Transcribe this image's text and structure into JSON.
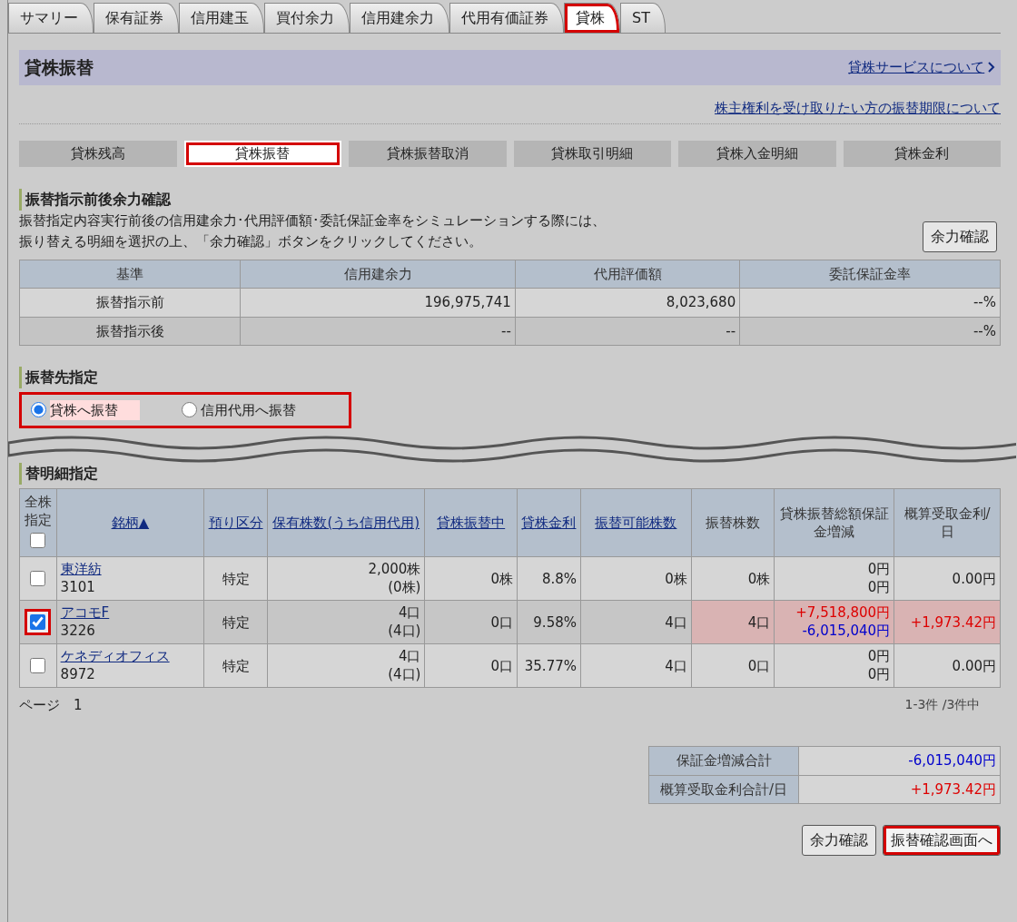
{
  "tabs": [
    {
      "label": "サマリー",
      "selected": false,
      "highlighted": false
    },
    {
      "label": "保有証券",
      "selected": false,
      "highlighted": false
    },
    {
      "label": "信用建玉",
      "selected": false,
      "highlighted": false
    },
    {
      "label": "買付余力",
      "selected": false,
      "highlighted": false
    },
    {
      "label": "信用建余力",
      "selected": false,
      "highlighted": false
    },
    {
      "label": "代用有価証券",
      "selected": false,
      "highlighted": false
    },
    {
      "label": "貸株",
      "selected": true,
      "highlighted": true
    },
    {
      "label": "ST",
      "selected": false,
      "highlighted": false
    }
  ],
  "page_title": "貸株振替",
  "service_link": "貸株サービスについて",
  "deadline_link": "株主権利を受け取りたい方の振替期限について",
  "subtabs": [
    {
      "label": "貸株残高",
      "selected": false,
      "highlighted": false
    },
    {
      "label": "貸株振替",
      "selected": true,
      "highlighted": true
    },
    {
      "label": "貸株振替取消",
      "selected": false,
      "highlighted": false
    },
    {
      "label": "貸株取引明細",
      "selected": false,
      "highlighted": false
    },
    {
      "label": "貸株入金明細",
      "selected": false,
      "highlighted": false
    },
    {
      "label": "貸株金利",
      "selected": false,
      "highlighted": false
    }
  ],
  "simulation": {
    "heading": "振替指示前後余力確認",
    "description": [
      "振替指定内容実行前後の信用建余力･代用評価額･委託保証金率をシミュレーションする際には、",
      "振り替える明細を選択の上、「余力確認」ボタンをクリックしてください。"
    ],
    "button": "余力確認",
    "columns": [
      "基準",
      "信用建余力",
      "代用評価額",
      "委託保証金率"
    ],
    "rows": [
      {
        "label": "振替指示前",
        "values": [
          "196,975,741",
          "8,023,680",
          "--%"
        ]
      },
      {
        "label": "振替指示後",
        "values": [
          "--",
          "--",
          "--%"
        ]
      }
    ]
  },
  "destination": {
    "heading": "振替先指定",
    "highlighted": true,
    "options": [
      {
        "label": "貸株へ振替",
        "selected": true
      },
      {
        "label": "信用代用へ振替",
        "selected": false
      }
    ]
  },
  "transfer": {
    "heading": "替明細指定",
    "columns": [
      {
        "label": "全株指定",
        "link": false
      },
      {
        "label": "銘柄▲",
        "link": true
      },
      {
        "label": "預り区分",
        "link": true
      },
      {
        "label": "保有株数(うち信用代用)",
        "link": true
      },
      {
        "label": "貸株振替中",
        "link": true
      },
      {
        "label": "貸株金利",
        "link": true
      },
      {
        "label": "振替可能株数",
        "link": true
      },
      {
        "label": "振替株数",
        "link": false
      },
      {
        "label": "貸株振替総額保証金増減",
        "link": false
      },
      {
        "label": "概算受取金利/日",
        "link": false
      }
    ],
    "select_all_checked": false,
    "rows": [
      {
        "name": "東洋紡",
        "code": "3101",
        "account": "特定",
        "held": "2,000株",
        "held_margin": "(0株)",
        "lending": "0株",
        "rate": "8.8%",
        "transferable": "0株",
        "transfer_qty": "0株",
        "total": {
          "text": "0円",
          "color": "#222222"
        },
        "guarantee": {
          "text": "0円",
          "color": "#222222"
        },
        "interest": {
          "text": "0.00円",
          "color": "#222222"
        },
        "checked": false,
        "highlighted": false
      },
      {
        "name": "アコモF",
        "code": "3226",
        "account": "特定",
        "held": "4口",
        "held_margin": "(4口)",
        "lending": "0口",
        "rate": "9.58%",
        "transferable": "4口",
        "transfer_qty": "4口",
        "total": {
          "text": "+7,518,800円",
          "color": "#dd0000"
        },
        "guarantee": {
          "text": "-6,015,040円",
          "color": "#0000cc"
        },
        "interest": {
          "text": "+1,973.42円",
          "color": "#dd0000"
        },
        "checked": true,
        "highlighted": true
      },
      {
        "name": "ケネディオフィス",
        "code": "8972",
        "account": "特定",
        "held": "4口",
        "held_margin": "(4口)",
        "lending": "0口",
        "rate": "35.77%",
        "transferable": "4口",
        "transfer_qty": "0口",
        "total": {
          "text": "0円",
          "color": "#222222"
        },
        "guarantee": {
          "text": "0円",
          "color": "#222222"
        },
        "interest": {
          "text": "0.00円",
          "color": "#222222"
        },
        "checked": false,
        "highlighted": false
      }
    ],
    "page_label": "ページ",
    "page": "1",
    "count": "1-3件 /3件中"
  },
  "summary": [
    {
      "label": "保証金増減合計",
      "value": "-6,015,040円",
      "color": "#0000cc"
    },
    {
      "label": "概算受取金利合計/日",
      "value": "+1,973.42円",
      "color": "#dd0000"
    }
  ],
  "buttons": [
    {
      "label": "余力確認",
      "highlighted": false
    },
    {
      "label": "振替確認画面へ",
      "highlighted": true
    }
  ]
}
